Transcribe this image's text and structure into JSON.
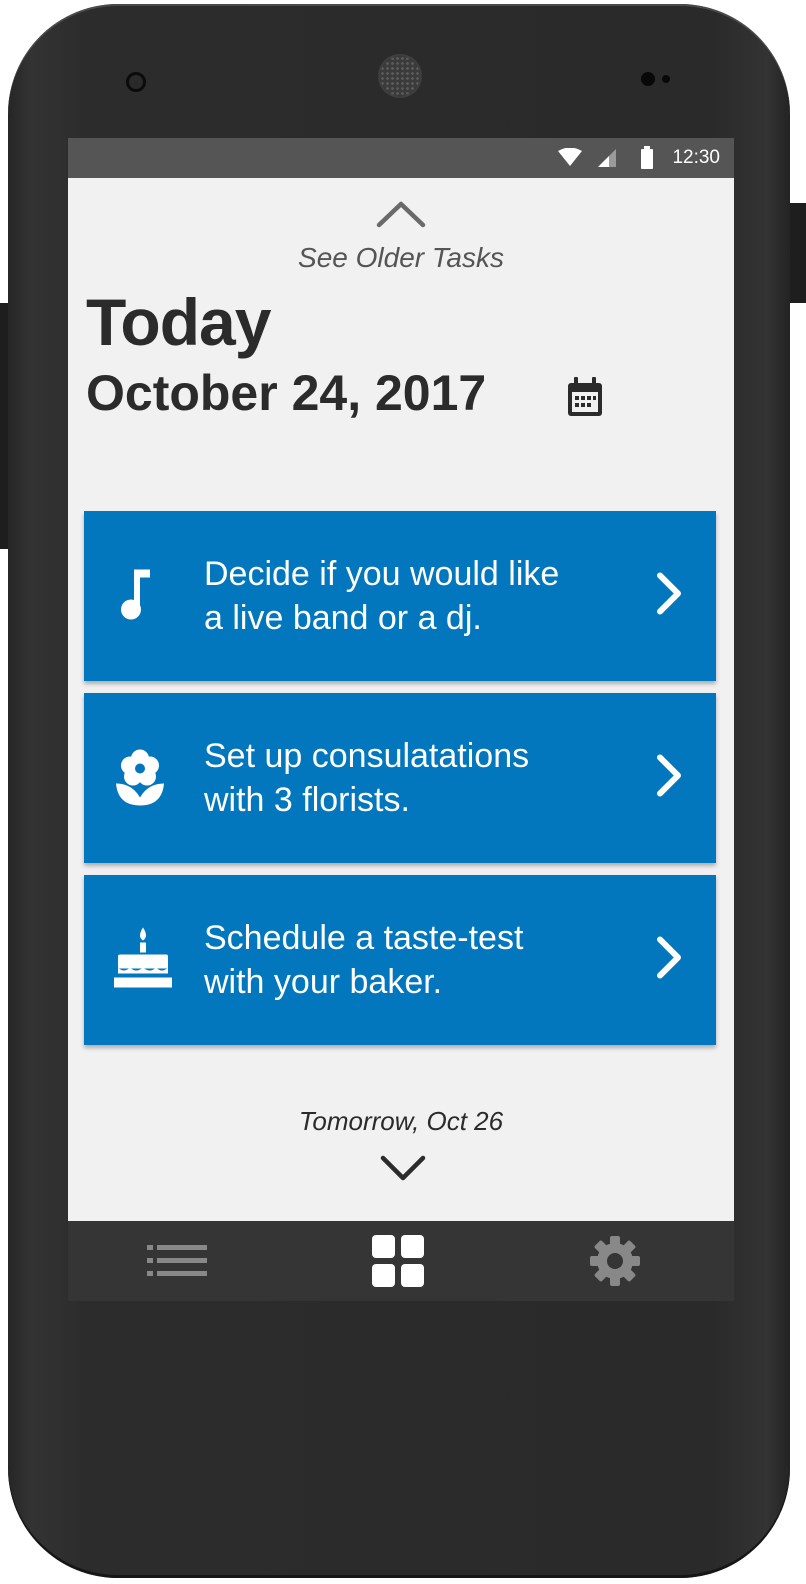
{
  "status_bar": {
    "time": "12:30"
  },
  "header": {
    "older_tasks_label": "See Older Tasks",
    "day_label": "Today",
    "date_label": "October 24, 2017"
  },
  "tasks": [
    {
      "icon": "music-note-icon",
      "line1": "Decide if you would like",
      "line2": "a live band or a dj."
    },
    {
      "icon": "flower-icon",
      "line1": "Set up consulatations",
      "line2": "with 3 florists."
    },
    {
      "icon": "cake-icon",
      "line1": "Schedule a taste-test",
      "line2": "with your baker."
    }
  ],
  "footer": {
    "next_day_label": "Tomorrow, Oct 26"
  },
  "bottom_nav": {
    "items": [
      {
        "icon": "list-icon",
        "active": false
      },
      {
        "icon": "grid-icon",
        "active": true
      },
      {
        "icon": "gear-icon",
        "active": false
      }
    ]
  },
  "colors": {
    "task_card": "#0277bd",
    "screen_background": "#f1f1f1",
    "status_bar": "#555555",
    "nav_bar": "#353535",
    "nav_active": "#ffffff",
    "nav_inactive": "#888888"
  }
}
